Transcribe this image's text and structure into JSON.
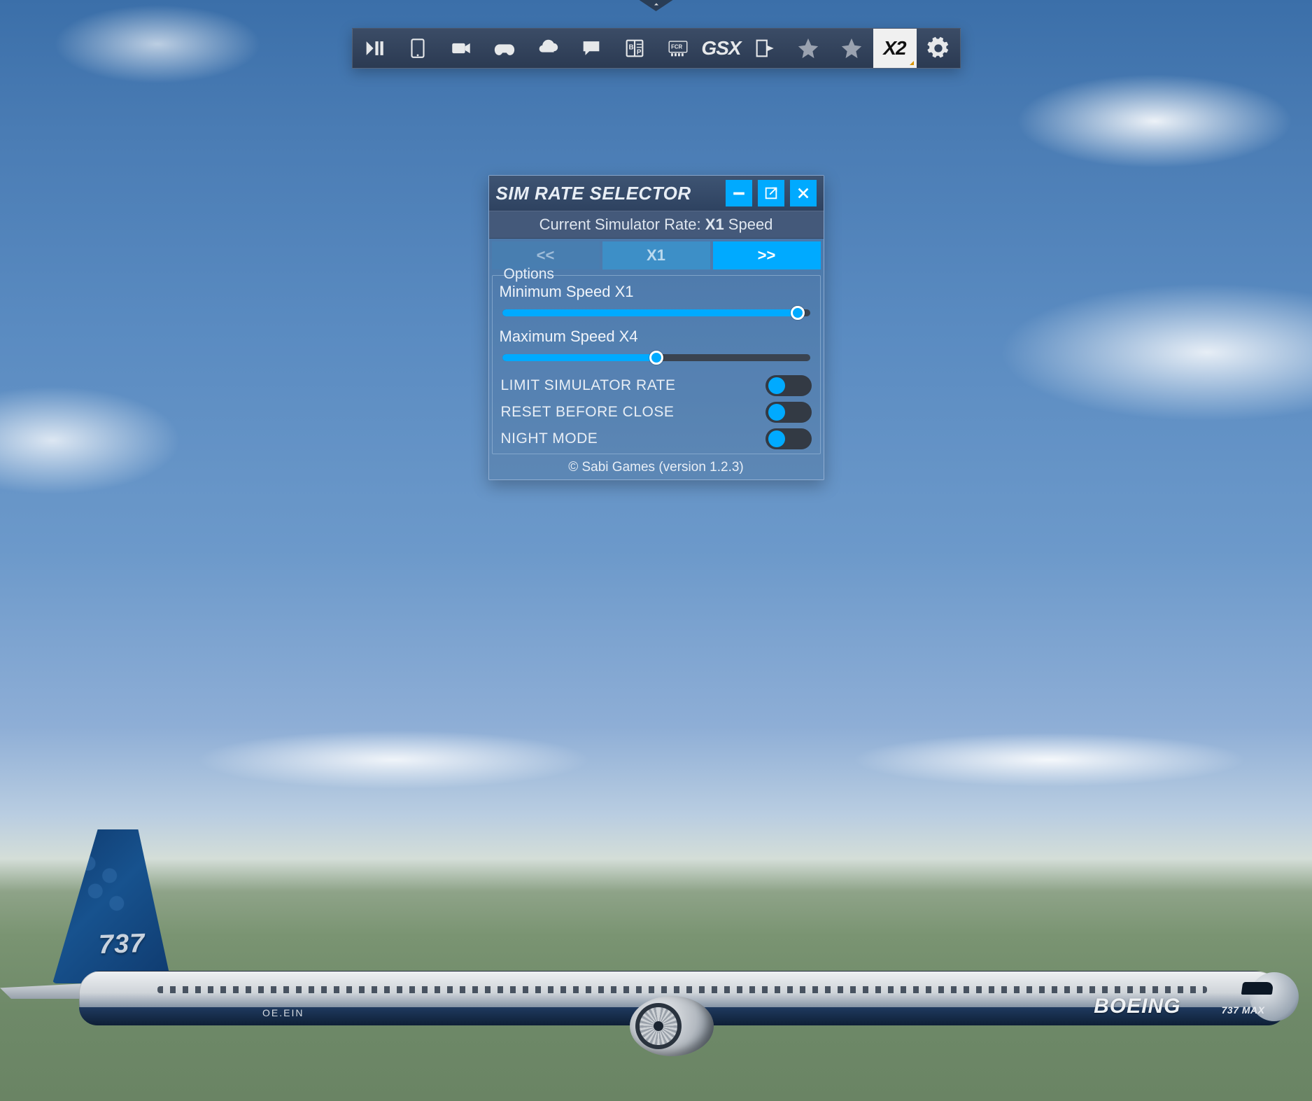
{
  "toolbar": {
    "items": [
      {
        "name": "pause-play-icon"
      },
      {
        "name": "tablet-icon"
      },
      {
        "name": "camera-icon"
      },
      {
        "name": "gamepad-icon"
      },
      {
        "name": "weather-cloud-icon"
      },
      {
        "name": "chat-icon"
      },
      {
        "name": "briefing-icon",
        "text": "B P"
      },
      {
        "name": "fcr-icon",
        "text": "FCR"
      },
      {
        "name": "gsx-icon",
        "text": "GSX"
      },
      {
        "name": "flight-plan-icon"
      },
      {
        "name": "star-icon"
      },
      {
        "name": "star-icon"
      },
      {
        "name": "sim-rate-icon",
        "text": "X2",
        "active": true
      },
      {
        "name": "settings-gear-icon"
      }
    ]
  },
  "panel": {
    "title": "SIM RATE SELECTOR",
    "current_label_prefix": "Current Simulator Rate: ",
    "current_rate": "X1",
    "current_label_suffix": " Speed",
    "buttons": {
      "slower": "<<",
      "reset": "X1",
      "faster": ">>"
    },
    "options_legend": "Options",
    "min_speed_label": "Minimum Speed X1",
    "min_speed_pct": 96,
    "max_speed_label": "Maximum Speed X4",
    "max_speed_pct": 50,
    "toggles": [
      {
        "label": "LIMIT SIMULATOR RATE",
        "on": false
      },
      {
        "label": "RESET BEFORE CLOSE",
        "on": false
      },
      {
        "label": "NIGHT MODE",
        "on": false
      }
    ],
    "footer": "© Sabi Games (version 1.2.3)"
  },
  "aircraft": {
    "tail_number": "737",
    "registration": "OE.EIN",
    "brand": "BOEING",
    "model": "737 MAX"
  }
}
